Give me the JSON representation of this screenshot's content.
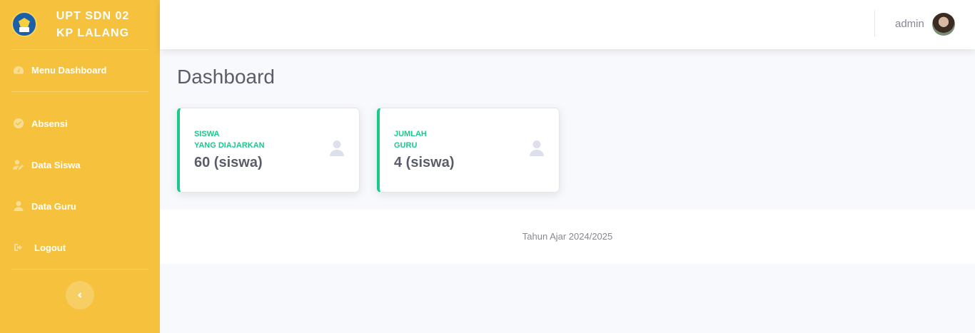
{
  "sidebar": {
    "brand_line1": "UPT SDN 02",
    "brand_line2": "KP LALANG",
    "logo": "tut-wuri-handayani-logo",
    "items": [
      {
        "label": "Menu Dashboard",
        "icon": "tachometer-icon"
      },
      {
        "label": "Absensi",
        "icon": "check-circle-icon"
      },
      {
        "label": "Data Siswa",
        "icon": "user-edit-icon"
      },
      {
        "label": "Data Guru",
        "icon": "user-icon"
      },
      {
        "label": "Logout",
        "icon": "sign-out-icon"
      }
    ],
    "toggle_icon": "chevron-left-icon"
  },
  "topbar": {
    "user_name": "admin",
    "avatar": "user-avatar"
  },
  "main": {
    "page_title": "Dashboard",
    "cards": [
      {
        "label_line1": "SISWA",
        "label_line2": "YANG DIAJARKAN",
        "value": "60 (siswa)",
        "icon": "user-icon"
      },
      {
        "label_line1": "JUMLAH",
        "label_line2": "GURU",
        "value": "4 (siswa)",
        "icon": "user-icon"
      }
    ]
  },
  "footer": {
    "text": "Tahun Ajar 2024/2025"
  },
  "colors": {
    "sidebar": "#f6c23e",
    "accent_success": "#1cc88a",
    "text_main": "#5a5c69",
    "text_muted": "#858796",
    "background": "#f8f9fc"
  }
}
